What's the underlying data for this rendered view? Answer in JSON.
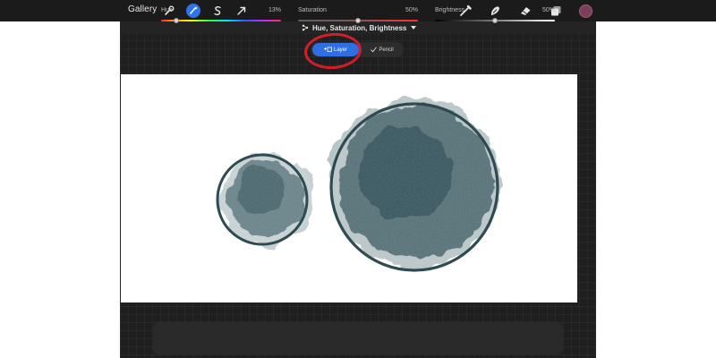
{
  "toolbar": {
    "gallery_label": "Gallery",
    "left_tools": [
      {
        "name": "wrench-icon"
      },
      {
        "name": "adjustments-wand-icon",
        "active": true
      },
      {
        "name": "selection-s-icon"
      },
      {
        "name": "transform-arrow-icon"
      }
    ],
    "right_tools": [
      {
        "name": "brush-icon"
      },
      {
        "name": "smudge-icon"
      },
      {
        "name": "eraser-icon"
      },
      {
        "name": "layers-icon"
      }
    ],
    "active_color": "#7d3e5c"
  },
  "adjustment": {
    "title": "Hue, Saturation, Brightness"
  },
  "mode": {
    "layer_label": "Layer",
    "pencil_label": "Pencil",
    "selected": "layer",
    "highlight_color": "#d21e2a"
  },
  "canvas": {
    "paint_color": "#2f4e56",
    "background": "#ffffff"
  },
  "sliders": [
    {
      "name": "hue",
      "label": "Hue",
      "value": "13%",
      "fraction": 0.13
    },
    {
      "name": "saturation",
      "label": "Saturation",
      "value": "50%",
      "fraction": 0.5
    },
    {
      "name": "brightness",
      "label": "Brightness",
      "value": "50%",
      "fraction": 0.5
    }
  ],
  "colors": {
    "accent": "#2e6fe3",
    "panel": "#2a2a2a",
    "background": "#1f1f1f"
  }
}
